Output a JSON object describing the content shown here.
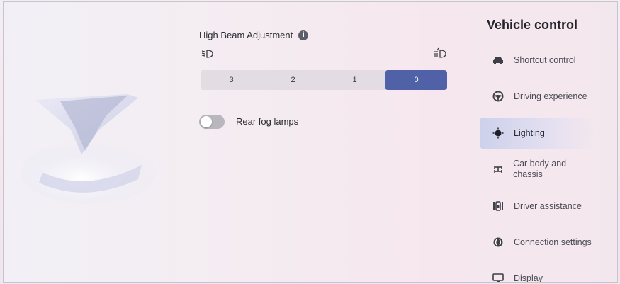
{
  "high_beam": {
    "title": "High Beam Adjustment",
    "levels": [
      "3",
      "2",
      "1",
      "0"
    ],
    "selected": "0"
  },
  "rear_fog": {
    "label": "Rear fog lamps",
    "enabled": false
  },
  "sidebar": {
    "title": "Vehicle control",
    "items": [
      {
        "label": "Shortcut control",
        "icon": "car-icon"
      },
      {
        "label": "Driving experience",
        "icon": "steering-wheel-icon"
      },
      {
        "label": "Lighting",
        "icon": "lightbulb-icon",
        "active": true
      },
      {
        "label": "Car body and chassis",
        "icon": "chassis-icon"
      },
      {
        "label": "Driver assistance",
        "icon": "driver-assist-icon"
      },
      {
        "label": "Connection settings",
        "icon": "connection-icon"
      },
      {
        "label": "Display",
        "icon": "display-icon"
      }
    ]
  },
  "colors": {
    "accent": "#5061a8",
    "active_nav_bg": "#cdd1ec"
  }
}
